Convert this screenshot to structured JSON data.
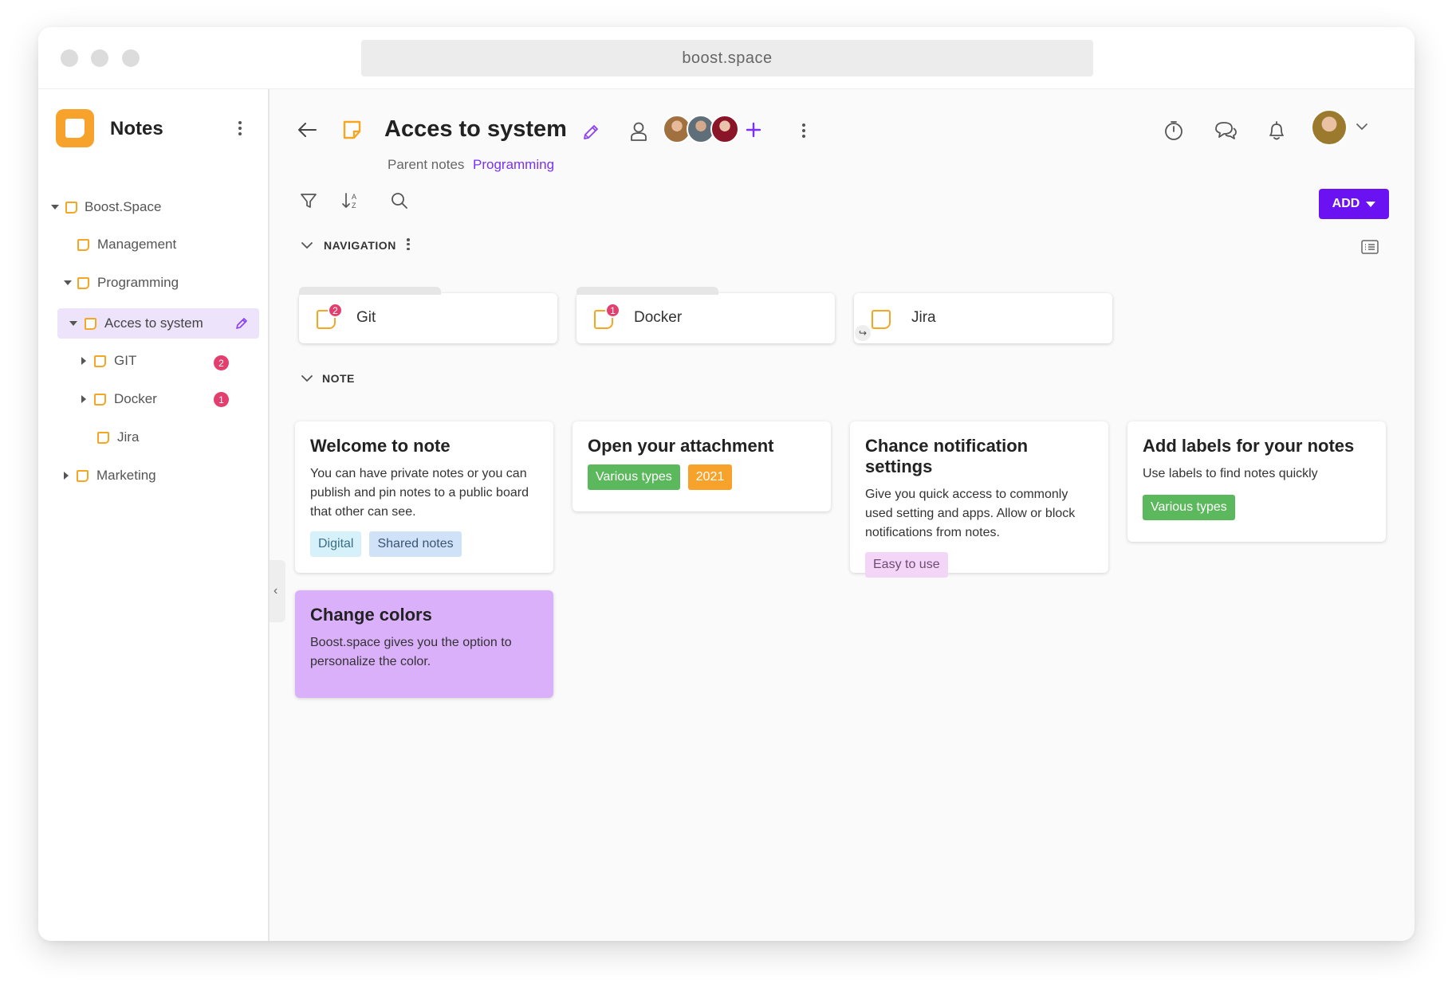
{
  "browser": {
    "url": "boost.space"
  },
  "app": {
    "title": "Notes"
  },
  "sidebar": {
    "items": [
      {
        "label": "Boost.Space"
      },
      {
        "label": "Management"
      },
      {
        "label": "Programming"
      },
      {
        "label": "Acces to system"
      },
      {
        "label": "GIT",
        "badge": "2"
      },
      {
        "label": "Docker",
        "badge": "1"
      },
      {
        "label": "Jira"
      },
      {
        "label": "Marketing"
      }
    ]
  },
  "header": {
    "title": "Acces to system",
    "parent_label": "Parent notes",
    "parent_link": "Programming",
    "add_label": "ADD"
  },
  "sections": {
    "navigation": "NAVIGATION",
    "note": "NOTE"
  },
  "nav_cards": [
    {
      "label": "Git",
      "badge": "2"
    },
    {
      "label": "Docker",
      "badge": "1"
    },
    {
      "label": "Jira"
    }
  ],
  "notes": [
    {
      "title": "Welcome to note",
      "text": "You can have private notes or you can publish and pin notes to a public board that other can see.",
      "tags": [
        "Digital",
        "Shared notes"
      ]
    },
    {
      "title": "Open your attachment",
      "tags": [
        "Various types",
        "2021"
      ]
    },
    {
      "title": "Chance notification settings",
      "text": "Give you quick access to commonly used setting and apps. Allow or block notifications from notes.",
      "tags": [
        "Easy to use"
      ]
    },
    {
      "title": "Add labels for your notes",
      "text": "Use labels to find notes quickly",
      "tags": [
        "Various types"
      ]
    },
    {
      "title": "Change colors",
      "text": "Boost.space gives you the option to personalize the color."
    }
  ],
  "colors": {
    "accent": "#6a12f2",
    "note_orange": "#f5a623",
    "badge_red": "#e23f6e",
    "tag_green": "#5cb85c",
    "tag_orange": "#f7a32b",
    "tag_light_blue": "#d7f1fb",
    "tag_blue": "#cfe2f8",
    "tag_lilac": "#f3d6f7",
    "card_purple": "#dbb0fb"
  }
}
